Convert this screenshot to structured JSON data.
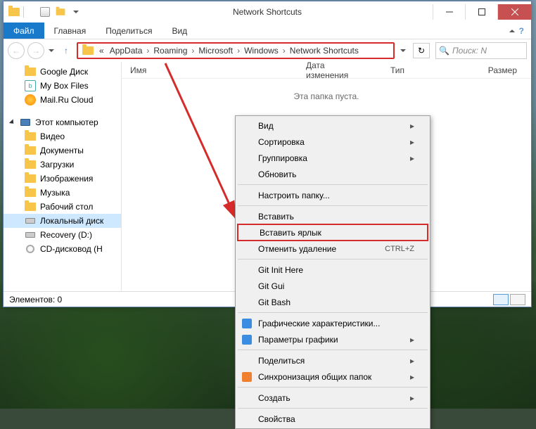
{
  "window": {
    "title": "Network Shortcuts"
  },
  "tabs": {
    "file": "Файл",
    "home": "Главная",
    "share": "Поделиться",
    "view": "Вид"
  },
  "breadcrumb": {
    "prefix": "«",
    "items": [
      "AppData",
      "Roaming",
      "Microsoft",
      "Windows",
      "Network Shortcuts"
    ]
  },
  "search": {
    "placeholder": "Поиск: N"
  },
  "sidebar": {
    "items": [
      {
        "label": "Google Диск",
        "icon": "gdrive"
      },
      {
        "label": "My Box Files",
        "icon": "box"
      },
      {
        "label": "Mail.Ru Cloud",
        "icon": "mailru"
      }
    ],
    "computer_label": "Этот компьютер",
    "computer_items": [
      {
        "label": "Видео",
        "icon": "folder"
      },
      {
        "label": "Документы",
        "icon": "folder"
      },
      {
        "label": "Загрузки",
        "icon": "folder"
      },
      {
        "label": "Изображения",
        "icon": "folder"
      },
      {
        "label": "Музыка",
        "icon": "folder"
      },
      {
        "label": "Рабочий стол",
        "icon": "folder"
      },
      {
        "label": "Локальный диск",
        "icon": "hdd",
        "selected": true
      },
      {
        "label": "Recovery (D:)",
        "icon": "hdd"
      },
      {
        "label": "CD-дисковод (H",
        "icon": "cd"
      }
    ]
  },
  "columns": {
    "name": "Имя",
    "date": "Дата изменения",
    "type": "Тип",
    "size": "Размер"
  },
  "content": {
    "empty": "Эта папка пуста."
  },
  "status": {
    "elements": "Элементов: 0"
  },
  "context_menu": {
    "groups": [
      [
        {
          "label": "Вид",
          "submenu": true
        },
        {
          "label": "Сортировка",
          "submenu": true
        },
        {
          "label": "Группировка",
          "submenu": true
        },
        {
          "label": "Обновить"
        }
      ],
      [
        {
          "label": "Настроить папку..."
        }
      ],
      [
        {
          "label": "Вставить"
        },
        {
          "label": "Вставить ярлык",
          "highlight": true
        },
        {
          "label": "Отменить удаление",
          "shortcut": "CTRL+Z"
        }
      ],
      [
        {
          "label": "Git Init Here"
        },
        {
          "label": "Git Gui"
        },
        {
          "label": "Git Bash"
        }
      ],
      [
        {
          "label": "Графические характеристики...",
          "icon": "blue"
        },
        {
          "label": "Параметры графики",
          "icon": "blue",
          "submenu": true
        }
      ],
      [
        {
          "label": "Поделиться",
          "submenu": true
        },
        {
          "label": "Синхронизация общих папок",
          "icon": "orange",
          "submenu": true
        }
      ],
      [
        {
          "label": "Создать",
          "submenu": true
        }
      ],
      [
        {
          "label": "Свойства"
        }
      ]
    ]
  }
}
